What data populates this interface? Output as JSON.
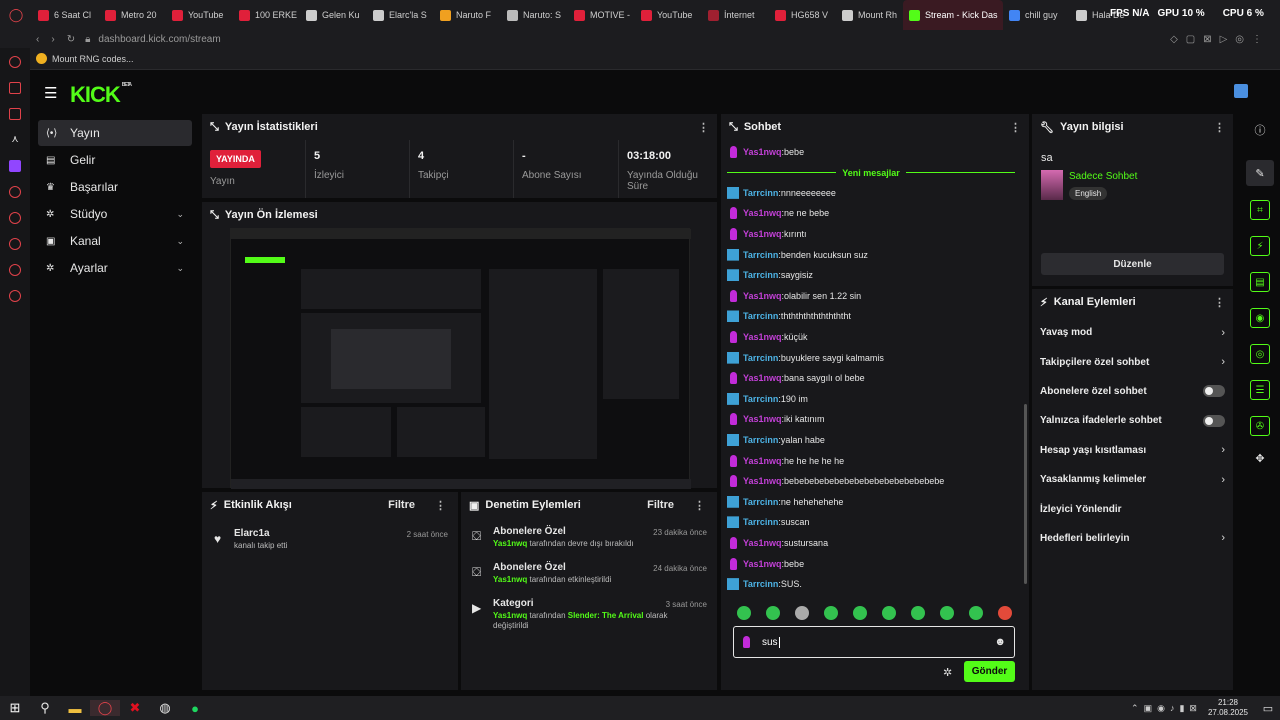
{
  "browser": {
    "tabs": [
      {
        "label": "6 Saat Cl",
        "color": "#e0203a"
      },
      {
        "label": "Metro 20",
        "color": "#e0203a"
      },
      {
        "label": "YouTube",
        "color": "#e0203a"
      },
      {
        "label": "100 ERKE",
        "color": "#e0203a"
      },
      {
        "label": "Gelen Ku",
        "color": "#cccccc"
      },
      {
        "label": "Elarc'la S",
        "color": "#cccccc"
      },
      {
        "label": "Naruto F",
        "color": "#f0a020"
      },
      {
        "label": "Naruto: S",
        "color": "#bbbbbb"
      },
      {
        "label": "MOTIVE -",
        "color": "#e0203a"
      },
      {
        "label": "YouTube",
        "color": "#e0203a"
      },
      {
        "label": "İnternet",
        "color": "#a02030"
      },
      {
        "label": "HG658 V",
        "color": "#e0203a"
      },
      {
        "label": "Mount Rh",
        "color": "#cccccc"
      },
      {
        "label": "Stream - Kick Das",
        "color": "#53fc18",
        "active": true
      },
      {
        "label": "chill guy",
        "color": "#4285f4"
      },
      {
        "label": "Hala De",
        "color": "#cccccc"
      }
    ],
    "address": "dashboard.kick.com/stream",
    "bookmark": "Mount RNG codes...",
    "overlay": {
      "fps": "FPS N/A",
      "gpu_label": "GPU",
      "gpu_value": "10 %",
      "cpu_label": "CPU",
      "cpu_value": "6 %"
    }
  },
  "nav": {
    "items": [
      {
        "label": "Yayın",
        "icon": "stream-icon",
        "active": true
      },
      {
        "label": "Gelir",
        "icon": "revenue-icon"
      },
      {
        "label": "Başarılar",
        "icon": "trophy-icon"
      },
      {
        "label": "Stüdyo",
        "icon": "gear-icon",
        "chevron": true
      },
      {
        "label": "Kanal",
        "icon": "channel-icon",
        "chevron": true
      },
      {
        "label": "Ayarlar",
        "icon": "gear-icon",
        "chevron": true
      }
    ]
  },
  "brand": {
    "logo": "KICK",
    "beta": "BETA"
  },
  "stats": {
    "title": "Yayın İstatistikleri",
    "live_badge": "YAYINDA",
    "cells": [
      {
        "value": "",
        "label": "Yayın"
      },
      {
        "value": "5",
        "label": "İzleyici"
      },
      {
        "value": "4",
        "label": "Takipçi"
      },
      {
        "value": "-",
        "label": "Abone Sayısı"
      },
      {
        "value": "03:18:00",
        "label": "Yayında Olduğu Süre"
      }
    ]
  },
  "preview": {
    "title": "Yayın Ön İzlemesi"
  },
  "activity": {
    "title": "Etkinlik Akışı",
    "filter": "Filtre",
    "items": [
      {
        "name": "Elarc1a",
        "desc": "kanalı takip etti",
        "time": "2 saat önce"
      }
    ]
  },
  "moderation": {
    "title": "Denetim Eylemleri",
    "filter": "Filtre",
    "items": [
      {
        "title": "Abonelere Özel",
        "user": "Yas1nwq",
        "desc": "tarafından devre dışı bırakıldı",
        "time": "23 dakika önce"
      },
      {
        "title": "Abonelere Özel",
        "user": "Yas1nwq",
        "desc": "tarafından etkinleştirildi",
        "time": "24 dakika önce"
      },
      {
        "title": "Kategori",
        "user": "Yas1nwq",
        "desc": "tarafından",
        "extra": "Slender: The Arrival",
        "desc2": "olarak değiştirildi",
        "time": "3 saat önce"
      }
    ]
  },
  "chat": {
    "title": "Sohbet",
    "new_messages": "Yeni mesajlar",
    "first": {
      "user": "Yas1nwq",
      "text": "bebe",
      "type": "mic"
    },
    "messages": [
      {
        "user": "Tarrcinn",
        "text": "nnneeeeeeee",
        "type": "mod"
      },
      {
        "user": "Yas1nwq",
        "text": "ne ne bebe",
        "type": "mic"
      },
      {
        "user": "Yas1nwq",
        "text": "kırıntı",
        "type": "mic"
      },
      {
        "user": "Tarrcinn",
        "text": "benden kucuksun suz",
        "type": "mod"
      },
      {
        "user": "Tarrcinn",
        "text": "saygisiz",
        "type": "mod"
      },
      {
        "user": "Yas1nwq",
        "text": "olabilir sen 1.22 sin",
        "type": "mic"
      },
      {
        "user": "Tarrcinn",
        "text": "thththththththththt",
        "type": "mod"
      },
      {
        "user": "Yas1nwq",
        "text": "küçük",
        "type": "mic"
      },
      {
        "user": "Tarrcinn",
        "text": "buyuklere saygi kalmamis",
        "type": "mod"
      },
      {
        "user": "Yas1nwq",
        "text": "bana saygılı ol bebe",
        "type": "mic"
      },
      {
        "user": "Tarrcinn",
        "text": "190 im",
        "type": "mod"
      },
      {
        "user": "Yas1nwq",
        "text": "iki katınım",
        "type": "mic"
      },
      {
        "user": "Tarrcinn",
        "text": "yalan habe",
        "type": "mod"
      },
      {
        "user": "Yas1nwq",
        "text": "he he he he he",
        "type": "mic"
      },
      {
        "user": "Yas1nwq",
        "text": "bebebebebebebebebebebebebebebebe",
        "type": "mic"
      },
      {
        "user": "Tarrcinn",
        "text": "ne hehehehehe",
        "type": "mod"
      },
      {
        "user": "Tarrcinn",
        "text": "suscan",
        "type": "mod"
      },
      {
        "user": "Yas1nwq",
        "text": "sustursana",
        "type": "mic"
      },
      {
        "user": "Yas1nwq",
        "text": "bebe",
        "type": "mic"
      },
      {
        "user": "Tarrcinn",
        "text": "SUS.",
        "type": "mod"
      }
    ],
    "input_value": "sus",
    "send": "Gönder"
  },
  "info": {
    "title": "Yayın bilgisi",
    "stream_title": "sa",
    "category": "Sadece Sohbet",
    "language": "English",
    "edit": "Düzenle"
  },
  "channel_actions": {
    "title": "Kanal Eylemleri",
    "items": [
      {
        "label": "Yavaş mod",
        "control": "arrow"
      },
      {
        "label": "Takipçilere özel sohbet",
        "control": "arrow"
      },
      {
        "label": "Abonelere özel sohbet",
        "control": "toggle"
      },
      {
        "label": "Yalnızca ifadelerle sohbet",
        "control": "toggle"
      },
      {
        "label": "Hesap yaşı kısıtlaması",
        "control": "arrow"
      },
      {
        "label": "Yasaklanmış kelimeler",
        "control": "arrow"
      },
      {
        "label": "İzleyici Yönlendir",
        "control": "none"
      },
      {
        "label": "Hedefleri belirleyin",
        "control": "arrow"
      }
    ]
  },
  "taskbar": {
    "time": "21:28",
    "date": "27.08.2025"
  }
}
